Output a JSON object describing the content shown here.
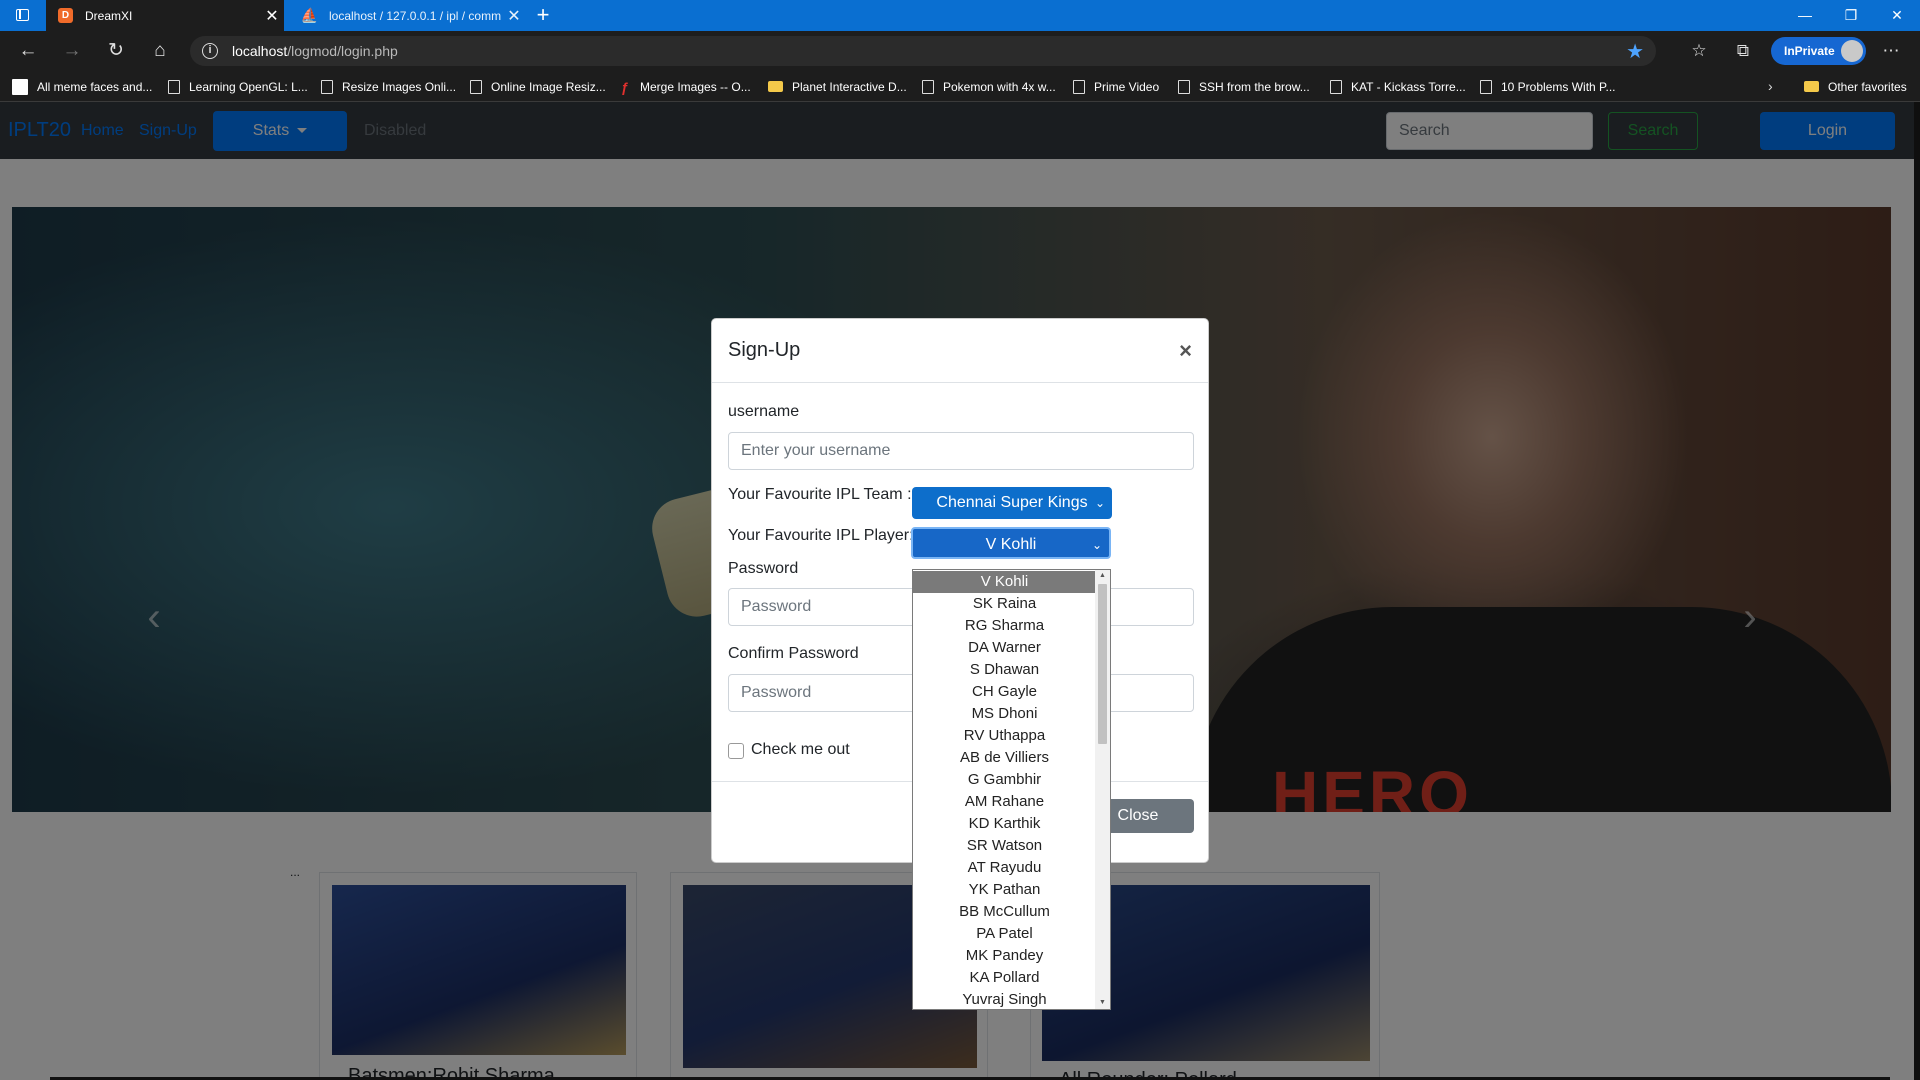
{
  "browser": {
    "tabs": [
      {
        "title": "DreamXI",
        "favicon": "dreamxi-favicon-icon"
      },
      {
        "title": "localhost / 127.0.0.1 / ipl / comm",
        "favicon": "phpmyadmin-favicon-icon"
      }
    ],
    "url_host": "localhost",
    "url_path": "/logmod/login.php",
    "inprivate_label": "InPrivate",
    "bookmarks": [
      "All meme faces and...",
      "Learning OpenGL: L...",
      "Resize Images Onli...",
      "Online Image Resiz...",
      "Merge Images -- O...",
      "Planet Interactive D...",
      "Pokemon with 4x w...",
      "Prime Video",
      "SSH from the brow...",
      "KAT - Kickass Torre...",
      "10 Problems With P..."
    ],
    "other_favorites": "Other favorites",
    "accent_color": "#0a6fd1"
  },
  "navbar": {
    "brand": "IPLT20",
    "home": "Home",
    "signup": "Sign-Up",
    "stats": "Stats",
    "disabled": "Disabled",
    "search_placeholder": "Search",
    "search_button": "Search",
    "login": "Login"
  },
  "hero": {
    "jersey_text": "HERO"
  },
  "cards": {
    "ellipsis": "...",
    "card1_title": "Batsmen:Rohit Sharma",
    "card3_title": "All Rounder: Pollard"
  },
  "modal": {
    "title": "Sign-Up",
    "close_x": "×",
    "username_label": "username",
    "username_placeholder": "Enter your username",
    "team_label": "Your Favourite IPL Team :",
    "team_value": "Chennai Super Kings",
    "player_label": "Your Favourite IPL Player:",
    "player_value": "V Kohli",
    "password_label": "Password",
    "password_placeholder": "Password",
    "confirm_label": "Confirm Password",
    "confirm_placeholder": "Password",
    "checkbox_label": "Check me out",
    "close_button": "Close"
  },
  "player_options": [
    "V Kohli",
    "SK Raina",
    "RG Sharma",
    "DA Warner",
    "S Dhawan",
    "CH Gayle",
    "MS Dhoni",
    "RV Uthappa",
    "AB de Villiers",
    "G Gambhir",
    "AM Rahane",
    "KD Karthik",
    "SR Watson",
    "AT Rayudu",
    "YK Pathan",
    "BB McCullum",
    "PA Patel",
    "MK Pandey",
    "KA Pollard",
    "Yuvraj Singh"
  ]
}
